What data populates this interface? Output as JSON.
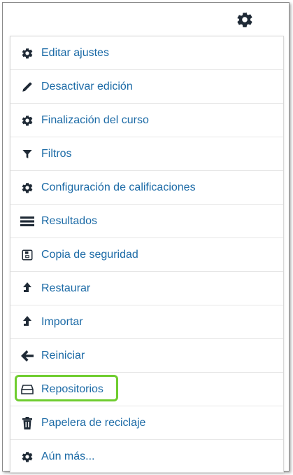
{
  "menu": {
    "items": [
      {
        "label": "Editar ajustes",
        "icon": "gear-icon"
      },
      {
        "label": "Desactivar edición",
        "icon": "pencil-icon"
      },
      {
        "label": "Finalización del curso",
        "icon": "gear-icon"
      },
      {
        "label": "Filtros",
        "icon": "filter-icon"
      },
      {
        "label": "Configuración de calificaciones",
        "icon": "gear-icon"
      },
      {
        "label": "Resultados",
        "icon": "list-icon"
      },
      {
        "label": "Copia de seguridad",
        "icon": "backup-icon"
      },
      {
        "label": "Restaurar",
        "icon": "arrow-up-icon"
      },
      {
        "label": "Importar",
        "icon": "arrow-up-icon"
      },
      {
        "label": "Reiniciar",
        "icon": "arrow-left-icon"
      },
      {
        "label": "Repositorios",
        "icon": "drive-icon"
      },
      {
        "label": "Papelera de reciclaje",
        "icon": "trash-icon"
      },
      {
        "label": "Aún más...",
        "icon": "gear-icon"
      }
    ]
  },
  "highlight_item": "Reiniciar",
  "colors": {
    "link": "#1b6aa6",
    "icon": "#1f2a36",
    "highlight": "#6fcd2f"
  }
}
